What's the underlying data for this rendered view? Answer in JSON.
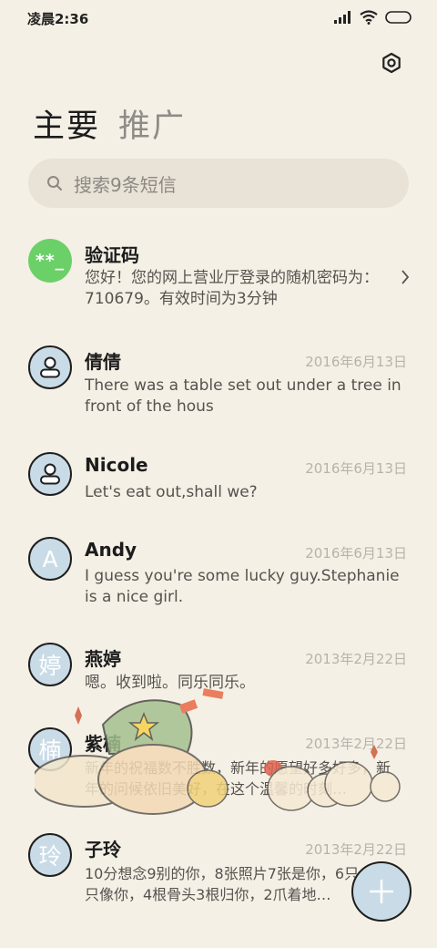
{
  "status_bar": {
    "time": "凌晨2:36"
  },
  "tabs": [
    {
      "label": "主要",
      "active": true
    },
    {
      "label": "推广",
      "active": false
    }
  ],
  "search": {
    "placeholder": "搜索9条短信"
  },
  "conversations": [
    {
      "name": "验证码",
      "date": "",
      "avatar_text": "**_",
      "avatar_type": "green",
      "preview": "您好！您的网上营业厅登录的随机密码为：710679。有效时间为3分钟"
    },
    {
      "name": "倩倩",
      "date": "2016年6月13日",
      "avatar_type": "person",
      "preview": "There was a table set out under a tree in front of the hous"
    },
    {
      "name": "Nicole",
      "date": "2016年6月13日",
      "avatar_type": "person",
      "preview": "Let's eat out,shall we?"
    },
    {
      "name": "Andy",
      "date": "2016年6月13日",
      "avatar_text": "A",
      "avatar_type": "letter",
      "preview": "I guess you're some lucky guy.Stephanie is a nice girl."
    },
    {
      "name": "燕婷",
      "date": "2013年2月22日",
      "avatar_text": "婷",
      "avatar_type": "letter",
      "preview": "嗯。收到啦。同乐同乐。"
    },
    {
      "name": "紫楠",
      "date": "2013年2月22日",
      "avatar_text": "楠",
      "avatar_type": "letter",
      "preview": "新年的祝福数不胜数，新年的愿望好多好多，新年的问候依旧美好，在这个温馨的时刻…"
    },
    {
      "name": "子玲",
      "date": "2013年2月22日",
      "avatar_text": "玲",
      "avatar_type": "letter",
      "preview": "10分想念9别的你，8张照片7张是你，6只小狗5只像你，4根骨头3根归你，2爪着地…"
    }
  ],
  "colors": {
    "background": "#f5f0e6",
    "accent_avatar": "#c9dbe6",
    "verify_avatar": "#6cd068",
    "search_bg": "#e8e2d7"
  },
  "icons": {
    "settings": "gear-icon",
    "search": "search-icon",
    "fab": "plus-icon",
    "chevron": "chevron-right-icon"
  }
}
